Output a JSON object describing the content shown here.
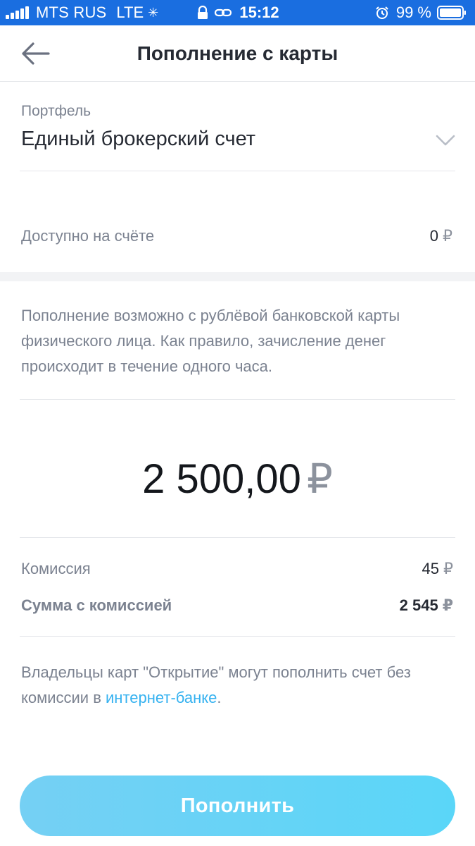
{
  "status_bar": {
    "carrier": "MTS RUS",
    "network": "LTE",
    "time": "15:12",
    "battery": "99 %",
    "icons": [
      "signal-icon",
      "loading-spinner-icon",
      "lock-icon",
      "link-icon",
      "alarm-icon",
      "battery-icon"
    ]
  },
  "header": {
    "title": "Пополнение с карты",
    "back_icon": "arrow-left-icon"
  },
  "portfolio": {
    "label": "Портфель",
    "value": "Единый брокерский счет",
    "chevron_icon": "chevron-down-icon"
  },
  "available": {
    "label": "Доступно на счёте",
    "amount": "0",
    "currency": "₽"
  },
  "info_text": "Пополнение возможно с рублёвой банковской карты физического лица. Как правило, зачисление денег происходит в течение одного часа.",
  "amount": {
    "value": "2 500,00",
    "currency": "₽"
  },
  "fees": {
    "commission_label": "Комиссия",
    "commission_value": "45",
    "total_label": "Сумма с комиссией",
    "total_value": "2 545",
    "currency": "₽"
  },
  "owners_note": {
    "text_before": "Владельцы карт \"Открытие\" могут пополнить счет без комиссии в ",
    "link_text": "интернет-банке",
    "text_after": "."
  },
  "submit": {
    "label": "Пополнить"
  },
  "colors": {
    "status_bar": "#1a6ee0",
    "accent_link": "#36b2f0",
    "button_start": "#75d0f4",
    "button_end": "#5ad6f8",
    "muted_text": "#7b8290"
  }
}
